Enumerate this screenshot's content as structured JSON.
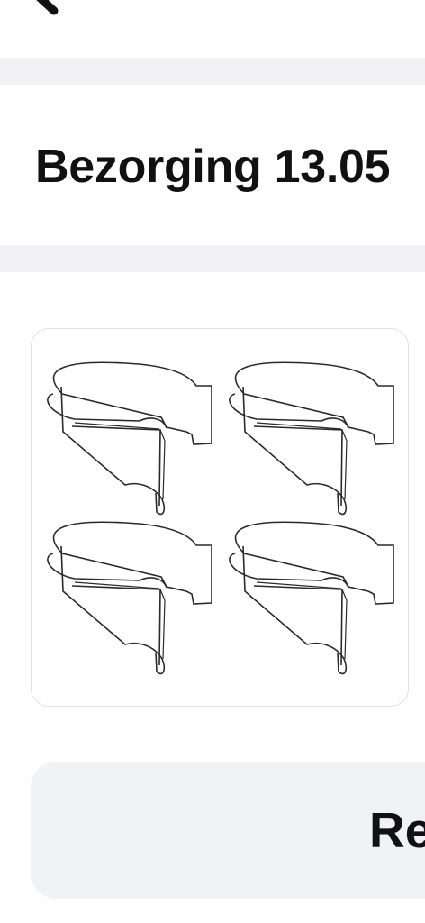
{
  "header": {
    "back_icon": "back-arrow-icon"
  },
  "delivery": {
    "title": "Bezorging 13.05"
  },
  "product": {
    "image_icon": "wire-pot-holder-image"
  },
  "action": {
    "label": "Re"
  },
  "colors": {
    "background": "#ffffff",
    "band": "#f2f2f6",
    "button": "#f1f2f6",
    "text": "#111111",
    "card_border": "#dfe1e6"
  }
}
